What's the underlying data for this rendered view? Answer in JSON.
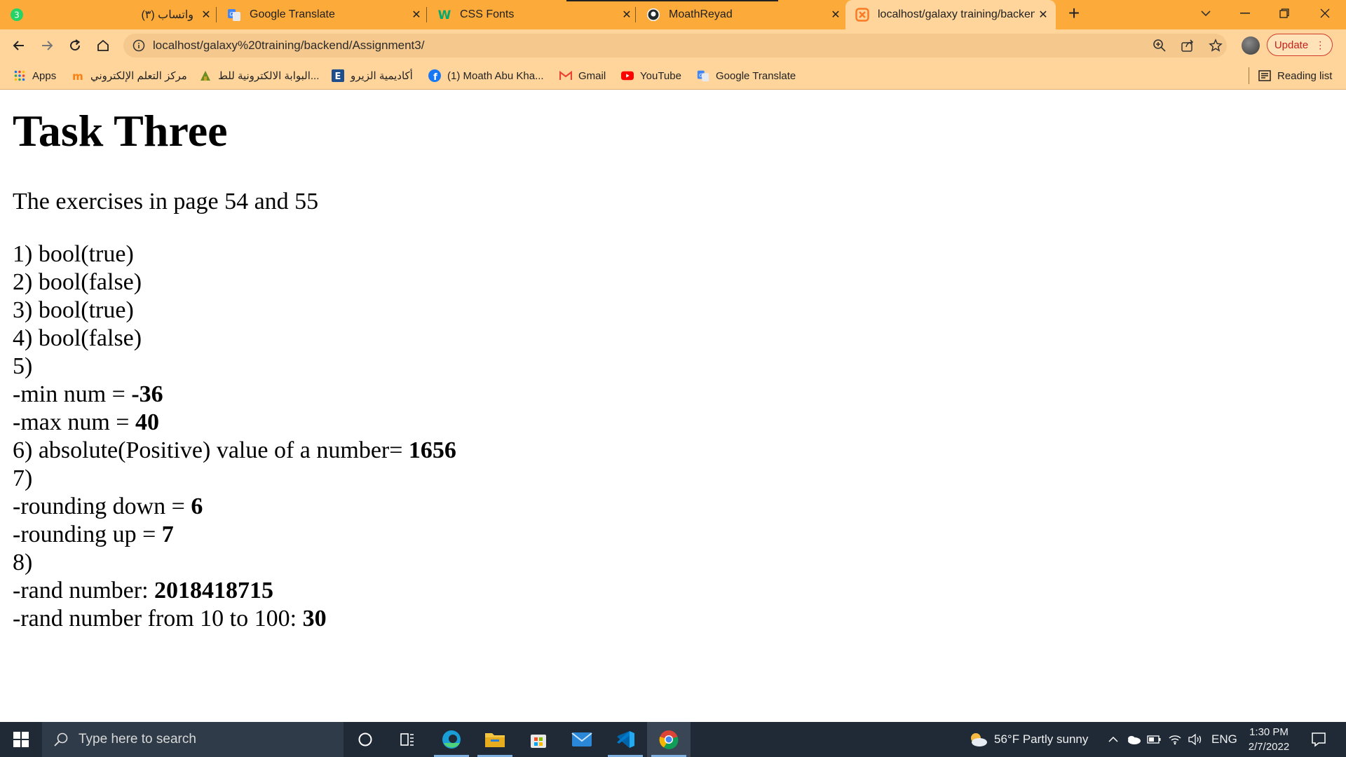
{
  "browser": {
    "tabs": [
      {
        "title": "(٣) واتساب",
        "icon": "whatsapp-icon",
        "badge": "3"
      },
      {
        "title": "Google Translate",
        "icon": "google-translate-icon"
      },
      {
        "title": "CSS Fonts",
        "icon": "w3schools-icon"
      },
      {
        "title": "MoathReyad",
        "icon": "github-icon"
      },
      {
        "title": "localhost/galaxy training/backend",
        "icon": "xampp-icon",
        "active": true
      }
    ],
    "close_glyph": "✕",
    "new_tab_glyph": "+",
    "url": "localhost/galaxy%20training/backend/Assignment3/",
    "update_label": "Update",
    "bookmarks": [
      {
        "label": "Apps",
        "icon": "apps-grid-icon"
      },
      {
        "label": "مركز التعلم الإلكتروني",
        "icon": "moodle-icon"
      },
      {
        "label": "البوابة الالكترونية للط...",
        "icon": "university-icon"
      },
      {
        "label": "أكاديمية الزيرو",
        "icon": "e-academy-icon"
      },
      {
        "label": "(1) Moath Abu Kha...",
        "icon": "facebook-icon"
      },
      {
        "label": "Gmail",
        "icon": "gmail-icon"
      },
      {
        "label": "YouTube",
        "icon": "youtube-icon"
      },
      {
        "label": "Google Translate",
        "icon": "google-translate-icon"
      }
    ],
    "reading_list": "Reading list"
  },
  "page": {
    "heading": "Task Three",
    "intro": "The exercises in page 54 and 55",
    "lines": [
      {
        "text": "1) bool(true)",
        "value": ""
      },
      {
        "text": "2) bool(false)",
        "value": ""
      },
      {
        "text": "3) bool(true)",
        "value": ""
      },
      {
        "text": "4) bool(false)",
        "value": ""
      },
      {
        "text": "5)",
        "value": ""
      },
      {
        "text": "-min num = ",
        "value": "-36"
      },
      {
        "text": "-max num = ",
        "value": "40"
      },
      {
        "text": "6) absolute(Positive) value of a number= ",
        "value": "1656"
      },
      {
        "text": "7)",
        "value": ""
      },
      {
        "text": "-rounding down = ",
        "value": "6"
      },
      {
        "text": "-rounding up = ",
        "value": "7"
      },
      {
        "text": "8)",
        "value": ""
      },
      {
        "text": "-rand number: ",
        "value": "2018418715"
      },
      {
        "text": "-rand number from 10 to 100: ",
        "value": "30"
      }
    ]
  },
  "taskbar": {
    "search_placeholder": "Type here to search",
    "weather": "56°F  Partly sunny",
    "language": "ENG",
    "time": "1:30 PM",
    "date": "2/7/2022",
    "apps": [
      "cortana-icon",
      "task-view-icon",
      "edge-icon",
      "file-explorer-icon",
      "microsoft-store-icon",
      "mail-icon",
      "vscode-icon",
      "chrome-icon"
    ]
  },
  "colors": {
    "tabstrip": "#fcab3a",
    "toolbar": "#ffd59c",
    "taskbar": "#1f2a36"
  }
}
